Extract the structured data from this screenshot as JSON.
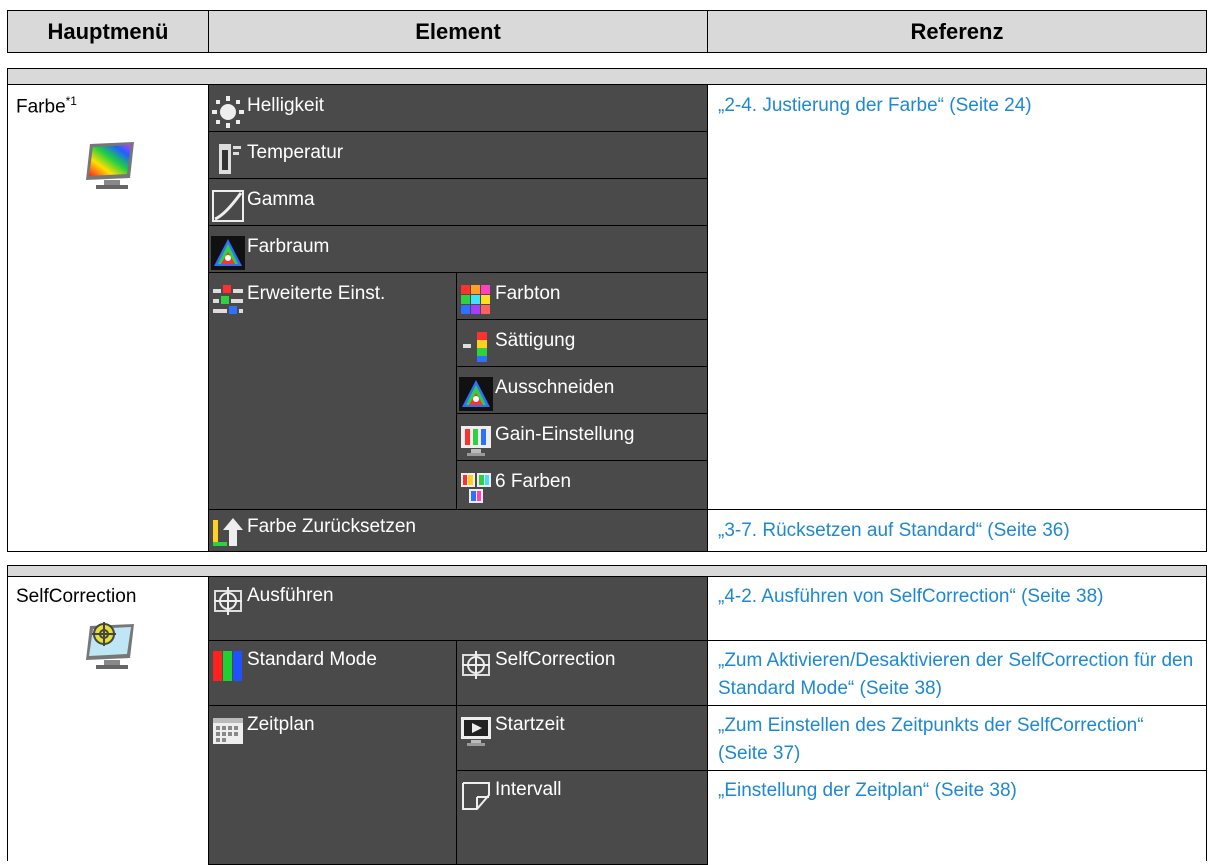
{
  "header": {
    "col1": "Hauptmenü",
    "col2": "Element",
    "col3": "Referenz"
  },
  "sections": {
    "farbe": {
      "menu_label": "Farbe",
      "menu_sup": "*1",
      "menu_icon": "color-monitor-icon",
      "items": {
        "helligkeit": "Helligkeit",
        "temperatur": "Temperatur",
        "gamma": "Gamma",
        "farbraum": "Farbraum",
        "erweiterte": "Erweiterte Einst.",
        "farbton": "Farbton",
        "saettigung": "Sättigung",
        "ausschneiden": "Ausschneiden",
        "gain": "Gain-Einstellung",
        "sechs_farben": "6 Farben",
        "zuruecksetzen": "Farbe Zurücksetzen"
      },
      "refs": {
        "justierung": "„2-4. Justierung der Farbe“ (Seite 24)",
        "ruecksetzen": "„3-7. Rücksetzen auf Standard“ (Seite 36)"
      }
    },
    "selfcorrection": {
      "menu_label": "SelfCorrection",
      "menu_icon": "selfcorrection-monitor-icon",
      "items": {
        "ausfuehren": "Ausführen",
        "standard_mode": "Standard Mode",
        "selfcorrection": "SelfCorrection",
        "zeitplan": "Zeitplan",
        "startzeit": "Startzeit",
        "intervall": "Intervall"
      },
      "refs": {
        "ausfuehren": "„4-2. Ausführen von SelfCorrection“ (Seite 38)",
        "aktivieren": "„Zum Aktivieren/Desaktivieren der SelfCorrection für den Standard Mode“ (Seite 38)",
        "zeitpunkt": "„Zum Einstellen des Zeitpunkts der SelfCorrection“ (Seite 37)",
        "zeitplan": "„Einstellung der Zeitplan“ (Seite 38)"
      }
    }
  },
  "colors": {
    "cell_bg": "#4a4a4a",
    "band_bg": "#d9d9d9",
    "link": "#1e88d0"
  }
}
